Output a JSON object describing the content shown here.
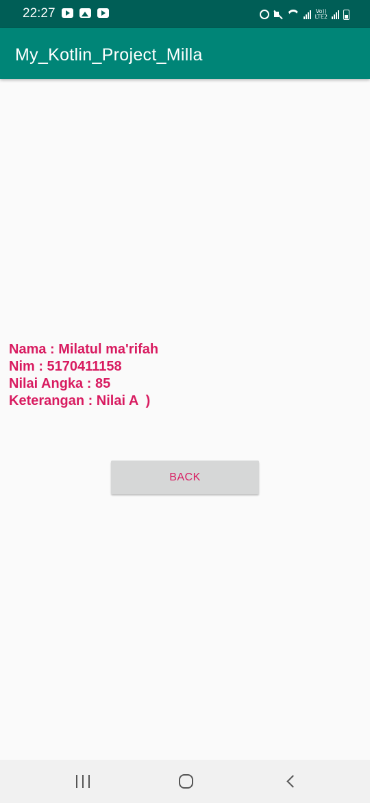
{
  "status_bar": {
    "time": "22:27",
    "left_icons": [
      "youtube-icon",
      "gallery-icon",
      "youtube-icon"
    ],
    "right_icons": [
      "alarm-icon",
      "mute-icon",
      "wifi-icon",
      "signal-icon",
      "lte2-icon",
      "signal-icon",
      "battery-icon"
    ],
    "lte_label": "Vo))\nLTE2",
    "background_color": "#005e56"
  },
  "toolbar": {
    "title": "My_Kotlin_Project_Milla",
    "background_color": "#008577"
  },
  "result": {
    "lines": [
      "Nama : Milatul ma'rifah",
      "Nim : 5170411158",
      "Nilai Angka : 85",
      "Keterangan : Nilai A  )"
    ],
    "text_color": "#d81b60"
  },
  "back_button": {
    "label": "BACK"
  },
  "nav_bar": {
    "buttons": [
      "recent-apps-icon",
      "home-icon",
      "back-icon"
    ]
  }
}
